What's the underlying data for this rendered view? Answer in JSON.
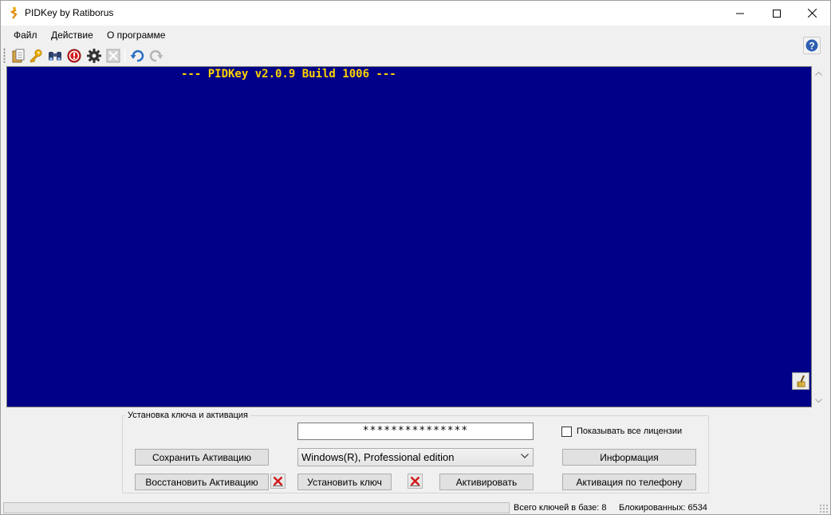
{
  "window": {
    "title": "PIDKey by Ratiborus"
  },
  "menu": {
    "items": [
      "Файл",
      "Действие",
      "О программе"
    ]
  },
  "toolbar": {
    "icons": [
      "paste-icon",
      "key-icon",
      "binoculars-icon",
      "stop-icon",
      "gear-icon",
      "close-icon",
      "undo-icon",
      "redo-icon"
    ]
  },
  "console": {
    "text": "--- PIDKey v2.0.9 Build 1006 ---",
    "background_color": "#000088",
    "text_color": "#ffd200"
  },
  "activation_group": {
    "title": "Установка ключа и активация",
    "key_value": "***************",
    "edition_selected": "Windows(R), Professional edition",
    "show_all_licenses_label": "Показывать все лицензии",
    "show_all_licenses_checked": false,
    "buttons": {
      "save_activation": "Сохранить Активацию",
      "restore_activation": "Восстановить Активацию",
      "install_key": "Установить ключ",
      "activate": "Активировать",
      "information": "Информация",
      "phone_activation": "Активация по телефону"
    }
  },
  "status": {
    "progress_fraction": 0,
    "total_keys": "Всего ключей в базе: 8",
    "blocked": "Блокированных: 6534"
  }
}
